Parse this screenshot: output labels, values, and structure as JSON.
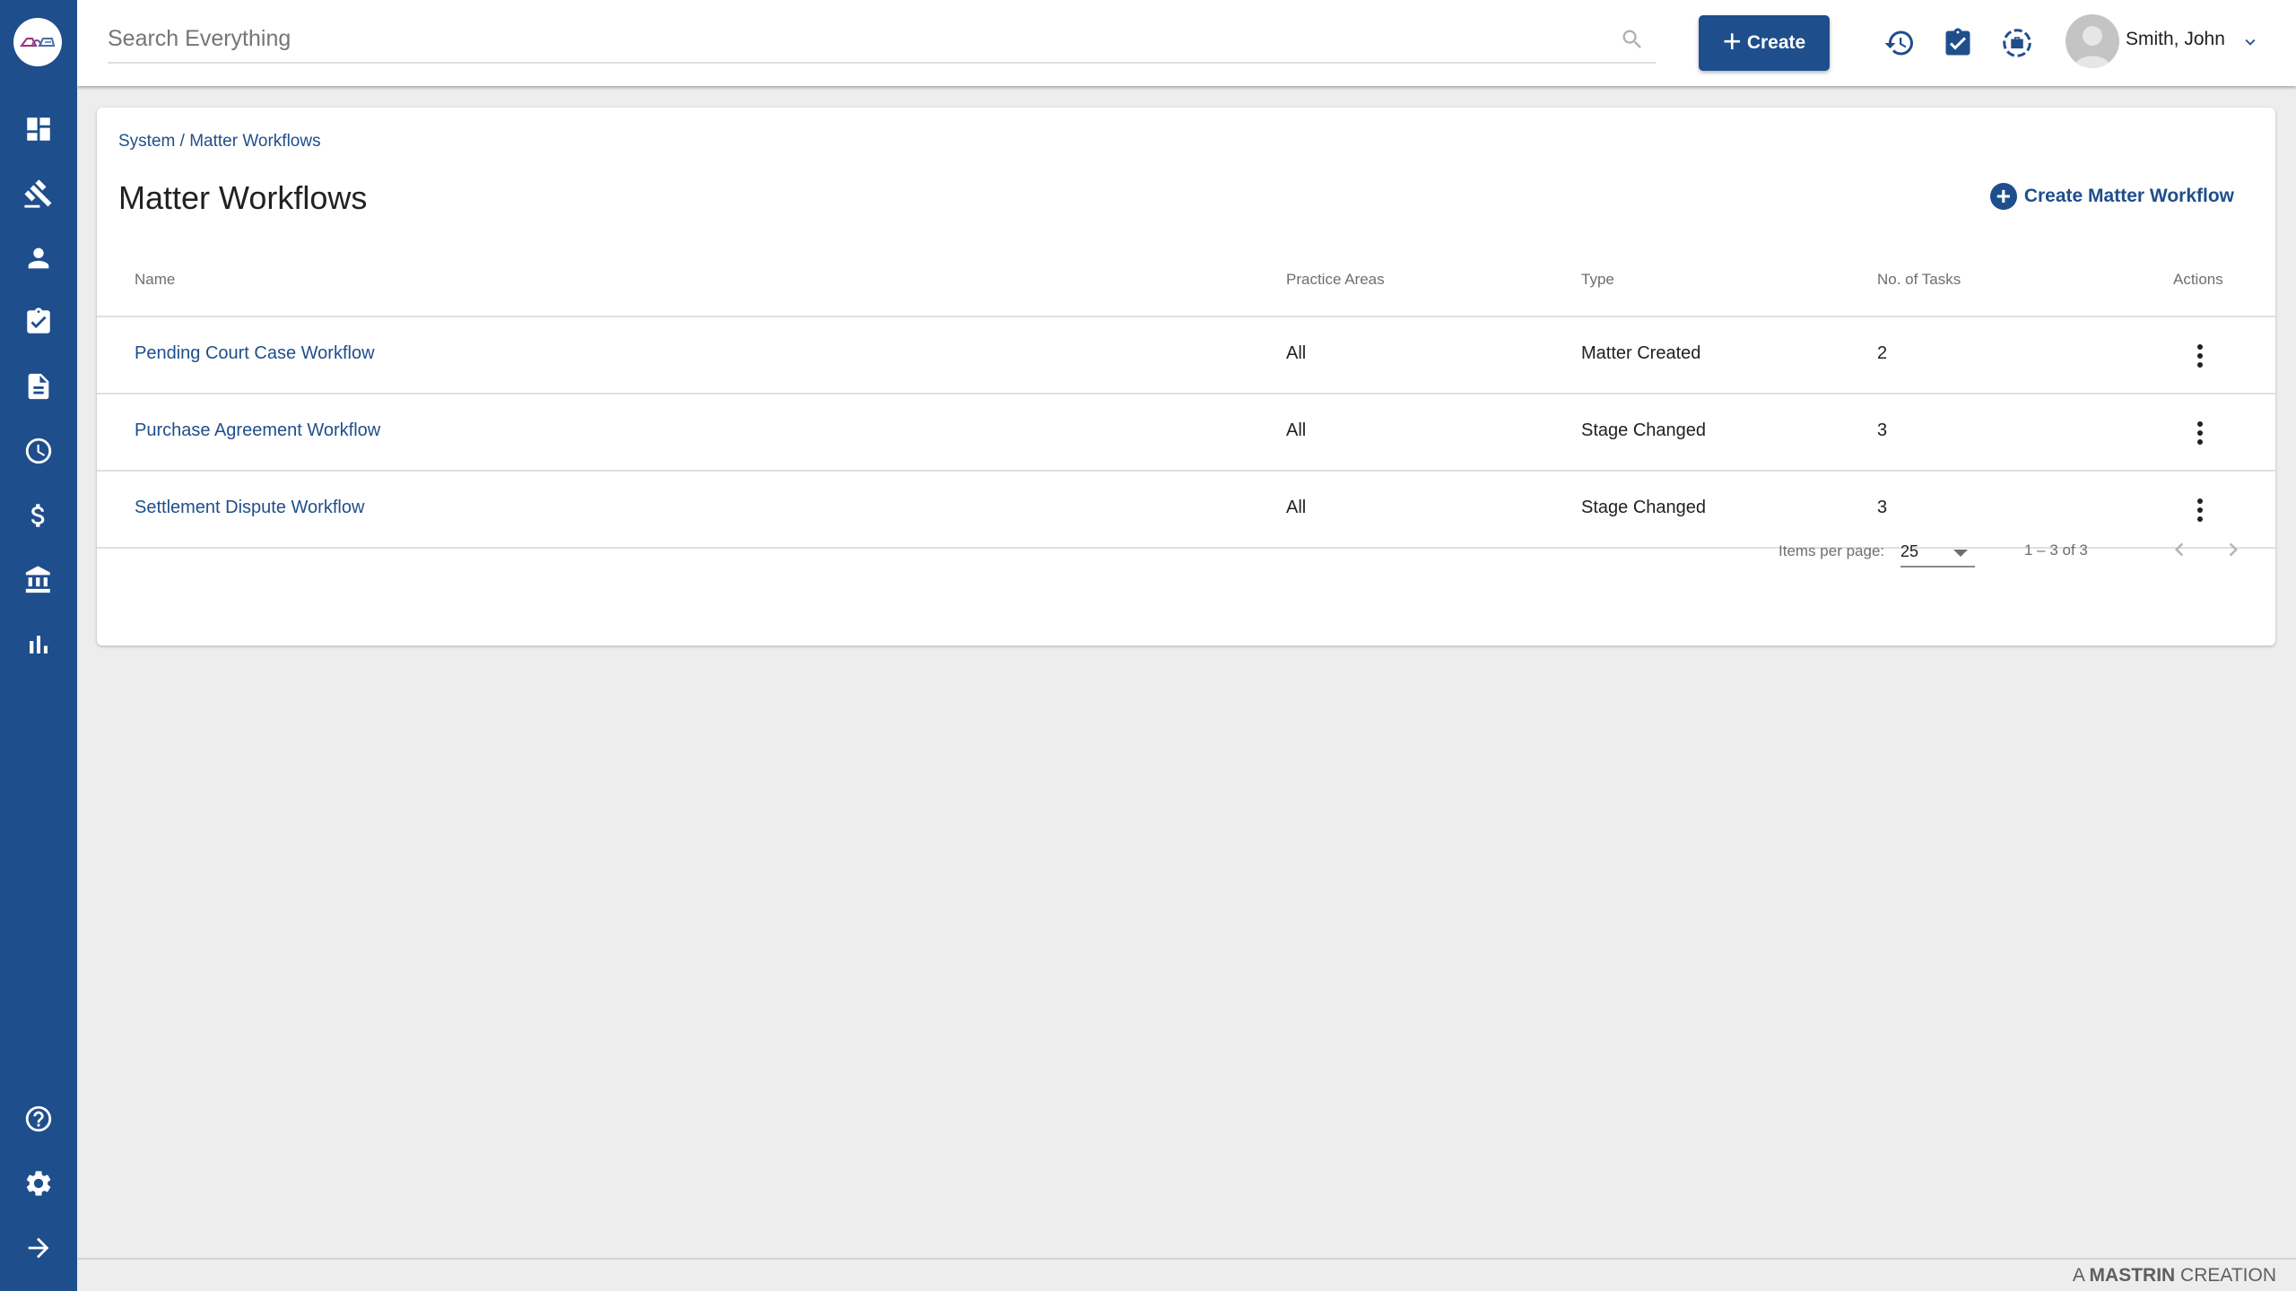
{
  "brand": {
    "primary": "#1f4e8c",
    "background": "#ededed"
  },
  "sidebar": {
    "logo": "app-logo",
    "items": [
      {
        "name": "dashboard",
        "icon": "dashboard-icon"
      },
      {
        "name": "matters",
        "icon": "gavel-icon"
      },
      {
        "name": "contacts",
        "icon": "person-icon"
      },
      {
        "name": "tasks",
        "icon": "clipboard-check-icon"
      },
      {
        "name": "documents",
        "icon": "document-icon"
      },
      {
        "name": "time",
        "icon": "clock-icon"
      },
      {
        "name": "billing",
        "icon": "dollar-icon"
      },
      {
        "name": "accounts",
        "icon": "bank-icon"
      },
      {
        "name": "reports",
        "icon": "bar-chart-icon"
      }
    ],
    "bottom_items": [
      {
        "name": "help",
        "icon": "help-icon"
      },
      {
        "name": "settings",
        "icon": "gear-icon"
      },
      {
        "name": "expand",
        "icon": "arrow-right-icon"
      }
    ]
  },
  "topbar": {
    "search_placeholder": "Search Everything",
    "search_value": "",
    "create_label": "Create",
    "icons": [
      "history-icon",
      "tasks-clipboard-icon",
      "briefcase-timer-icon"
    ],
    "user_name": "Smith, John"
  },
  "page": {
    "breadcrumb": [
      "System",
      "Matter Workflows"
    ],
    "breadcrumb_separator": " / ",
    "title": "Matter Workflows",
    "create_action_label": "Create Matter Workflow"
  },
  "table": {
    "columns": [
      "Name",
      "Practice Areas",
      "Type",
      "No. of Tasks",
      "Actions"
    ],
    "rows": [
      {
        "name": "Pending Court Case Workflow",
        "practice_areas": "All",
        "type": "Matter Created",
        "tasks": "2"
      },
      {
        "name": "Purchase Agreement Workflow",
        "practice_areas": "All",
        "type": "Stage Changed",
        "tasks": "3"
      },
      {
        "name": "Settlement Dispute Workflow",
        "practice_areas": "All",
        "type": "Stage Changed",
        "tasks": "3"
      }
    ]
  },
  "paginator": {
    "items_per_page_label": "Items per page:",
    "items_per_page": "25",
    "range_label": "1 – 3 of 3"
  },
  "footer": {
    "prefix": "A ",
    "brand": "MASTRIN",
    "suffix": " CREATION"
  }
}
